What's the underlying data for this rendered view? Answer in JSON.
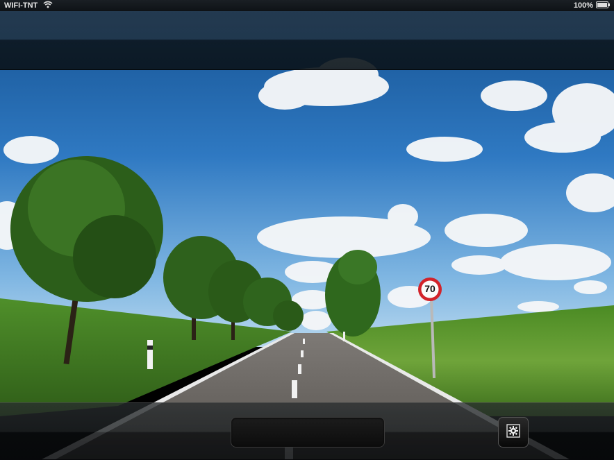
{
  "status_bar": {
    "carrier": "WIFI-TNT",
    "wifi_icon": "wifi-icon",
    "battery_percent": "100%",
    "battery_icon": "battery-icon"
  },
  "photo": {
    "sign_text": "70"
  },
  "toolbar": {
    "settings_icon": "gear-icon"
  },
  "colors": {
    "sky_top": "#1f5fa8",
    "sky_bottom": "#8fc0e6",
    "grass": "#5c9a2c",
    "road": "#6a6662"
  }
}
